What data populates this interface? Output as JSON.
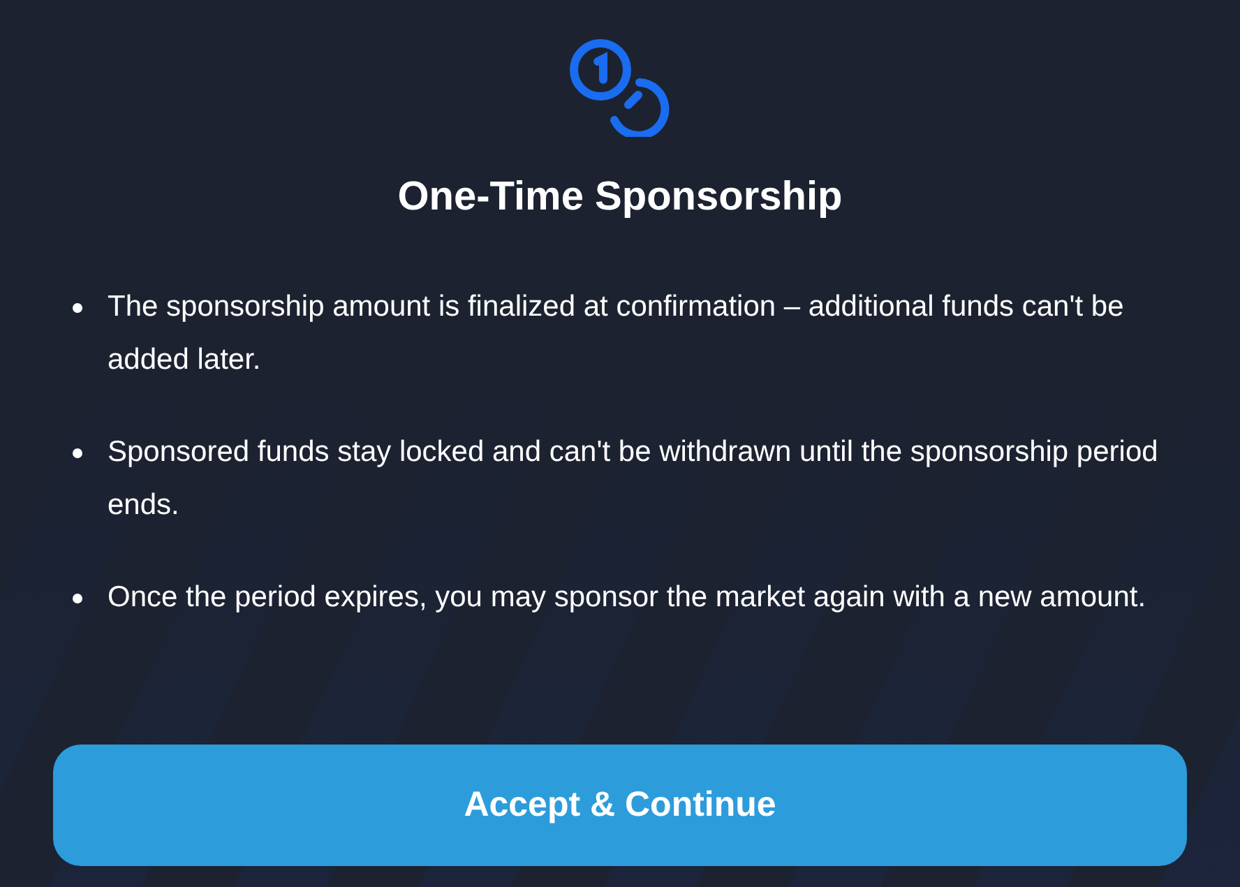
{
  "title": "One-Time Sponsorship",
  "bullets": [
    "The sponsorship amount is finalized at confirmation – additional funds can't be added later.",
    "Sponsored funds stay locked and can't be withdrawn until the sponsorship period ends.",
    "Once the period expires, you may sponsor the market again with a new amount."
  ],
  "button": "Accept & Continue"
}
